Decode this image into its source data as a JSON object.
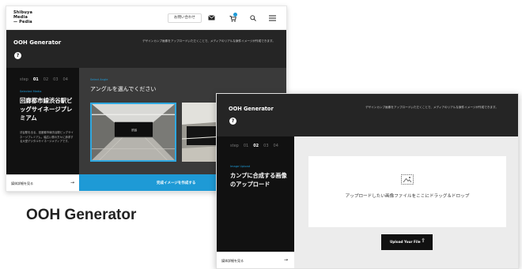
{
  "screen_a": {
    "logo_lines": [
      "Shibuya",
      "Media",
      "— Pedia"
    ],
    "header": {
      "contact_label": "お問い合わせ"
    },
    "hero": {
      "title": "OOH Generator",
      "help_symbol": "?",
      "description": "デザインカンプ画像をアップロードいただくことで、メディアのリアルな案件イメージが作成できます。"
    },
    "steps": {
      "prefix": "step",
      "items": [
        "01",
        "02",
        "03",
        "04"
      ],
      "active": "01"
    },
    "step_panel": {
      "kicker": "Selected Media",
      "title": "回廊都市線渋谷駅ビッグサイネージプレミアム",
      "description": "渋谷駅を出る、回廊都市線渋谷駅ビッグサイネージプレミアム。幅広い層の方々に訴求する大型デジタルサイネージメディアです。"
    },
    "sidebar_link": {
      "label": "媒体詳細を見る",
      "arrow": "→"
    },
    "main": {
      "kicker": "Select Angle",
      "heading": "アングルを選んでください",
      "thumb_sign_text": "渋谷"
    },
    "cta": {
      "label": "完成イメージを作成する"
    }
  },
  "caption": "OOH Generator",
  "screen_b": {
    "hero": {
      "title": "OOH Generator",
      "help_symbol": "?",
      "description": "デザインカンプ画像をアップロードいただくことで、メディアのリアルな案件イメージが作成できます。"
    },
    "steps": {
      "prefix": "step",
      "items": [
        "01",
        "02",
        "03",
        "04"
      ],
      "active": "02"
    },
    "step_panel": {
      "kicker": "Image Upload",
      "title": "カンプに合成する画像のアップロード"
    },
    "sidebar_link": {
      "label": "媒体詳細を見る",
      "arrow": "→"
    },
    "dropzone": {
      "text": "アップロードしたい画像ファイルをここにドラッグ＆ドロップ"
    },
    "upload_button": {
      "label": "Upload Your File",
      "icon": "⇪"
    }
  },
  "colors": {
    "accent": "#1e9ad6",
    "dark_panel": "#111111",
    "hero_bg": "#252525",
    "upload_area_bg": "#ececec"
  },
  "icons": [
    "mail-icon",
    "cart-icon",
    "search-icon",
    "menu-icon",
    "image-placeholder-icon",
    "upload-icon",
    "arrow-right-icon"
  ]
}
